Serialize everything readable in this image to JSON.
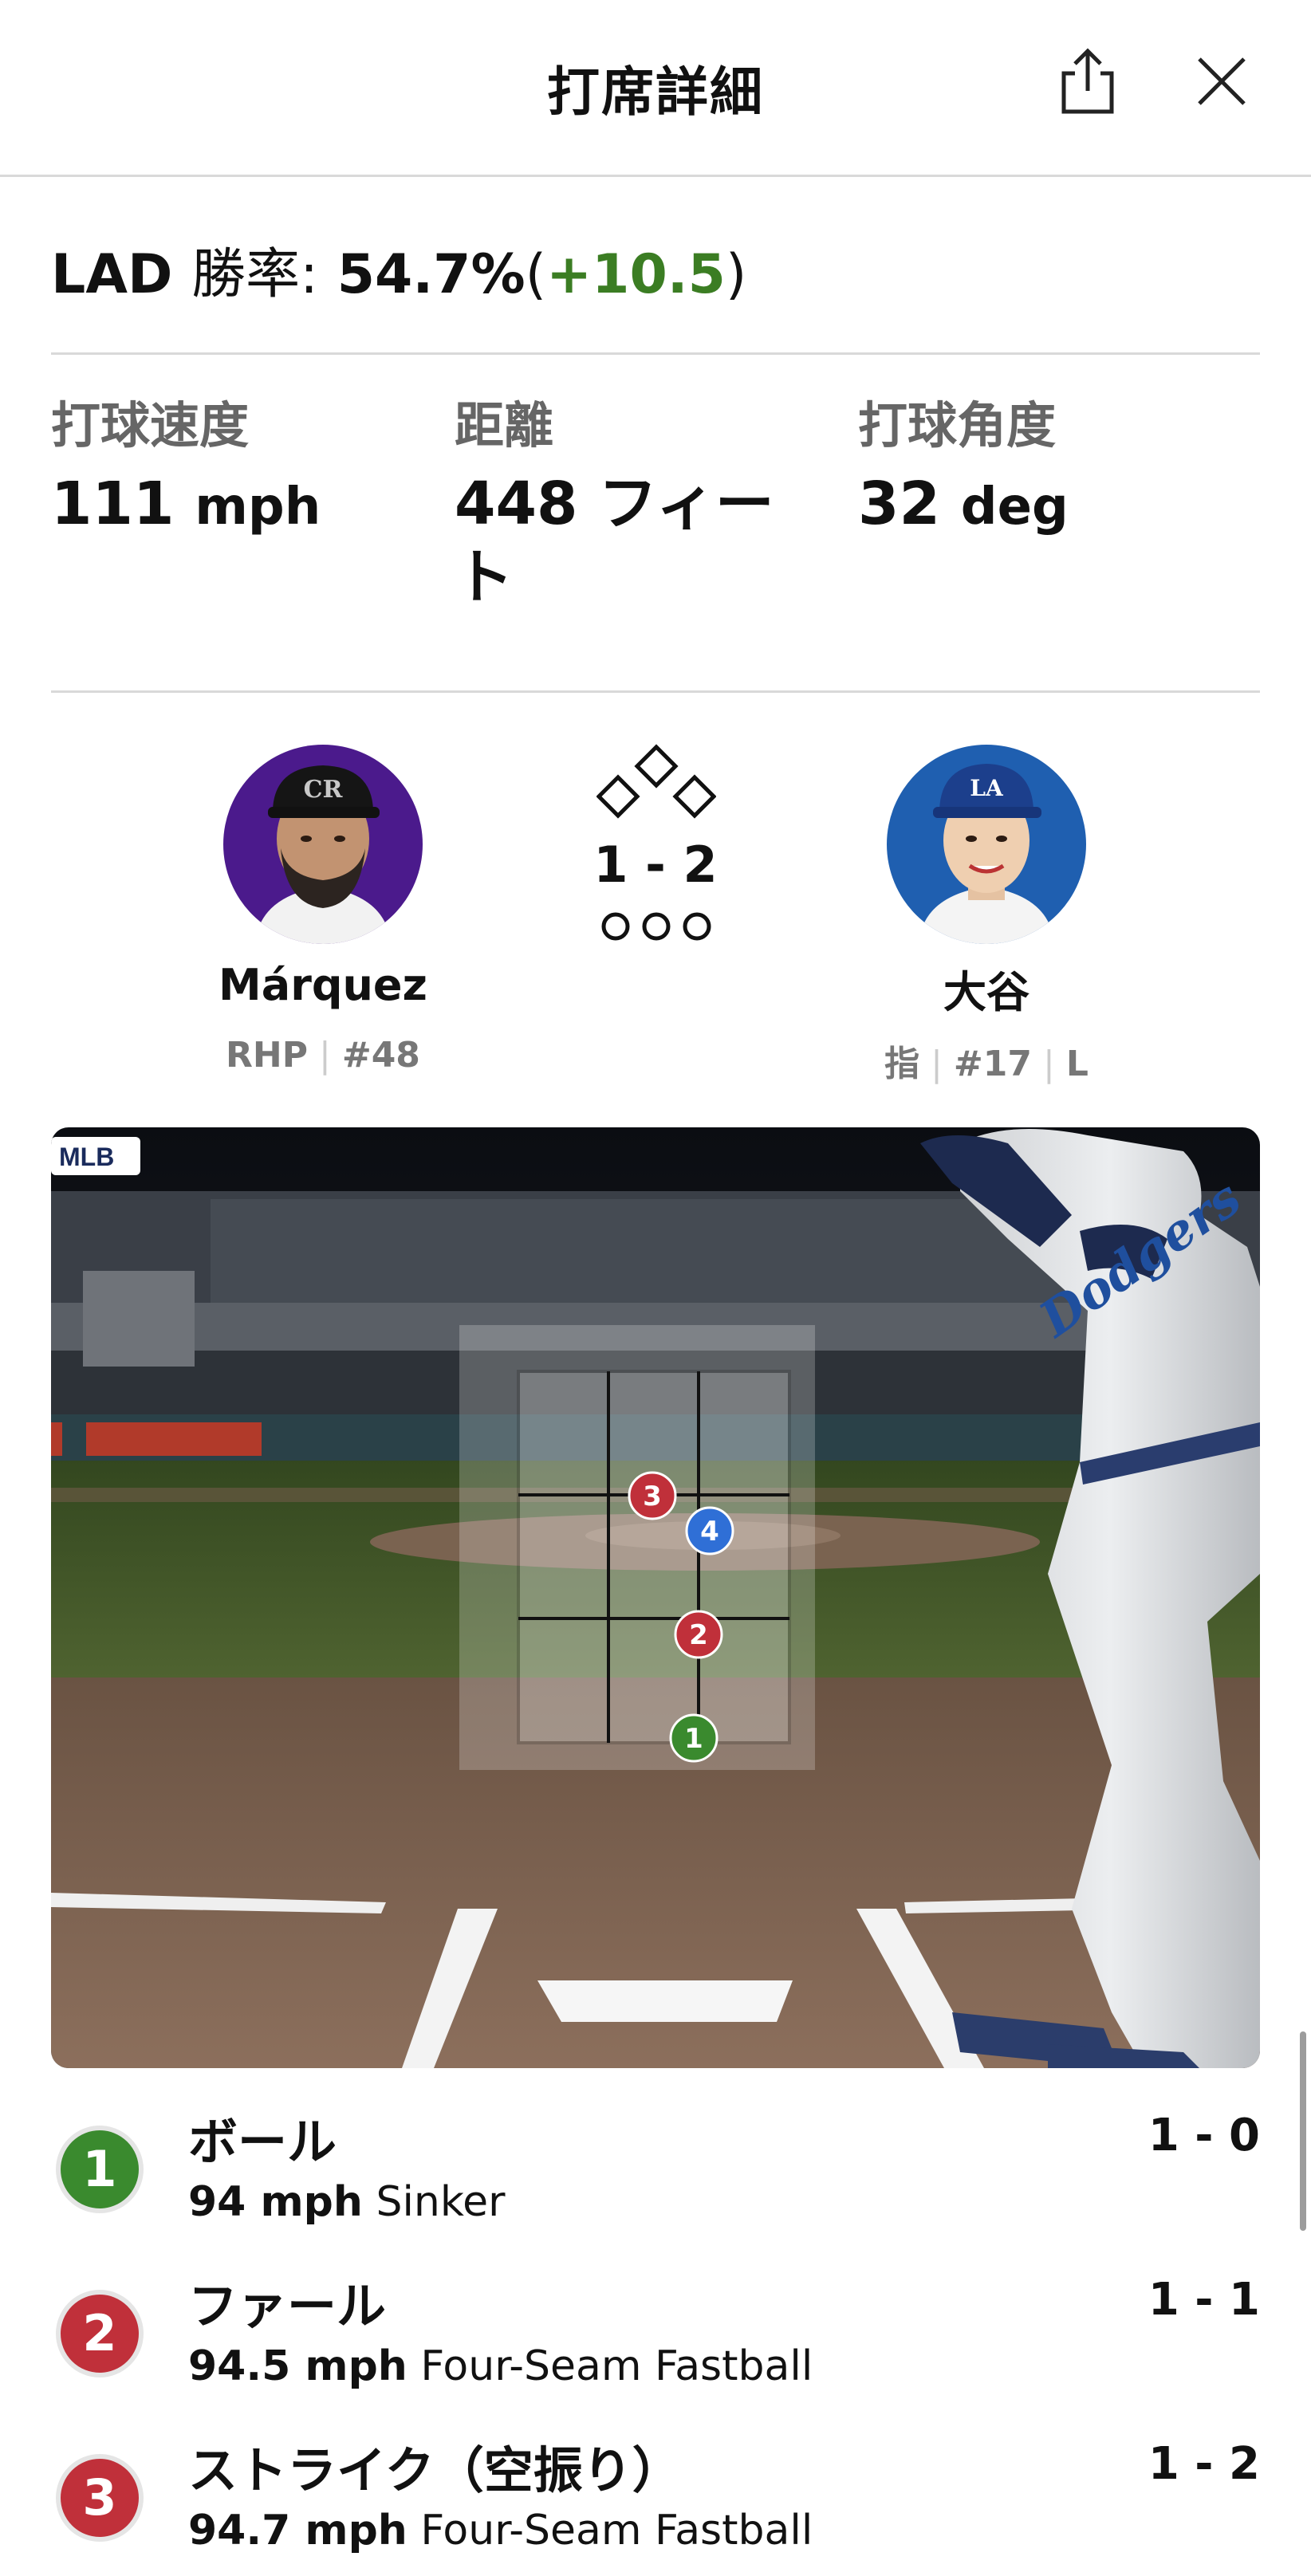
{
  "header": {
    "title": "打席詳細"
  },
  "win_probability": {
    "team": "LAD",
    "label": "勝率:",
    "value": "54.7%",
    "open_paren": "(",
    "delta": "+10.5",
    "close_paren": ")"
  },
  "stats": [
    {
      "label": "打球速度",
      "value": "111",
      "unit": "mph"
    },
    {
      "label": "距離",
      "value": "448",
      "unit": "フィート"
    },
    {
      "label": "打球角度",
      "value": "32",
      "unit": "deg"
    }
  ],
  "pitcher": {
    "name": "Márquez",
    "position": "RHP",
    "number": "#48",
    "team_logo_text": "CR"
  },
  "batter": {
    "name": "大谷",
    "position": "指",
    "number": "#17",
    "bats": "L",
    "team_logo_text": "LA"
  },
  "situation": {
    "count": "1 - 2",
    "outs": 0,
    "runners_on": []
  },
  "field": {
    "mlb_logo_text": "MLB",
    "jersey_text": "Dodgers"
  },
  "pitch_markers": [
    {
      "n": "1",
      "color": "#3a8a2e"
    },
    {
      "n": "2",
      "color": "#c0303a"
    },
    {
      "n": "3",
      "color": "#c0303a"
    },
    {
      "n": "4",
      "color": "#2f6fd6"
    }
  ],
  "pitches": [
    {
      "n": "1",
      "color": "#3a8a2e",
      "result": "ボール",
      "speed": "94 mph",
      "type": "Sinker",
      "count": "1 - 0"
    },
    {
      "n": "2",
      "color": "#c0303a",
      "result": "ファール",
      "speed": "94.5 mph",
      "type": "Four-Seam Fastball",
      "count": "1 - 1"
    },
    {
      "n": "3",
      "color": "#c0303a",
      "result": "ストライク（空振り）",
      "speed": "94.7 mph",
      "type": "Four-Seam Fastball",
      "count": "1 - 2"
    }
  ],
  "colors": {
    "positive": "#3b7d23",
    "ball": "#3a8a2e",
    "strike": "#c0303a",
    "in_play": "#2f6fd6",
    "rockies_purple": "#4b1a8c",
    "dodgers_blue": "#1f5fb0"
  }
}
